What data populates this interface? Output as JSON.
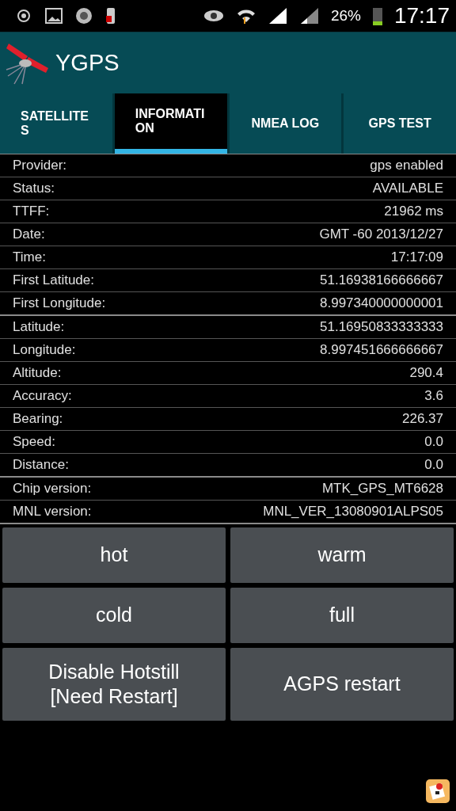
{
  "status_bar": {
    "battery": "26%",
    "time": "17:17"
  },
  "app_bar": {
    "title": "YGPS"
  },
  "tabs": [
    {
      "label": "SATELLITE\nS",
      "selected": false
    },
    {
      "label": "INFORMATI\nON",
      "selected": true
    },
    {
      "label": "NMEA LOG",
      "selected": false
    },
    {
      "label": "GPS TEST",
      "selected": false
    }
  ],
  "sections": [
    [
      {
        "label": "Provider:",
        "value": "gps enabled"
      },
      {
        "label": "Status:",
        "value": "AVAILABLE"
      },
      {
        "label": "TTFF:",
        "value": "21962 ms"
      },
      {
        "label": "Date:",
        "value": "GMT -60 2013/12/27"
      },
      {
        "label": "Time:",
        "value": "17:17:09"
      },
      {
        "label": "First Latitude:",
        "value": "51.16938166666667"
      },
      {
        "label": "First Longitude:",
        "value": "8.997340000000001"
      }
    ],
    [
      {
        "label": "Latitude:",
        "value": "51.16950833333333"
      },
      {
        "label": "Longitude:",
        "value": "8.997451666666667"
      },
      {
        "label": "Altitude:",
        "value": "290.4"
      },
      {
        "label": "Accuracy:",
        "value": "3.6"
      },
      {
        "label": "Bearing:",
        "value": "226.37"
      },
      {
        "label": "Speed:",
        "value": "0.0"
      },
      {
        "label": "Distance:",
        "value": "0.0"
      }
    ],
    [
      {
        "label": "Chip version:",
        "value": "MTK_GPS_MT6628"
      },
      {
        "label": "MNL version:",
        "value": "MNL_VER_13080901ALPS05"
      }
    ]
  ],
  "buttons": [
    "hot",
    "warm",
    "cold",
    "full",
    "Disable Hotstill\n[Need Restart]",
    "AGPS restart"
  ]
}
